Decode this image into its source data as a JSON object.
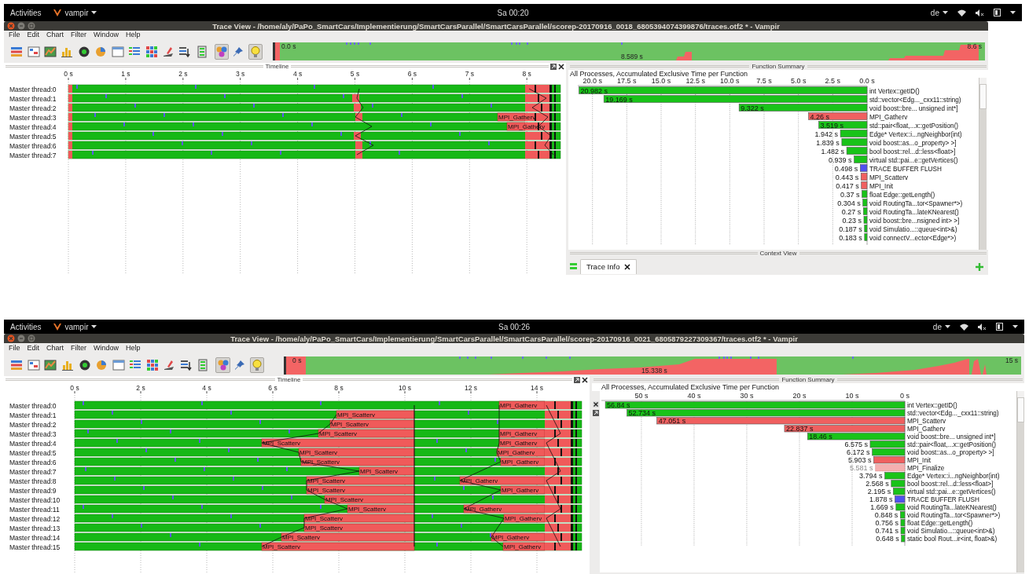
{
  "windows": [
    {
      "top_bar": {
        "activities": "Activities",
        "app_menu": "vampir",
        "clock": "Sa 00:20",
        "language": "de"
      },
      "title": "Trace View - /home/aly/PaPo_SmartCars/Implementierung/SmartCarsParallel/SmartCarsParallel/scorep-20170916_0018_6805394074399876/traces.otf2 * - Vampir",
      "menu": [
        "File",
        "Edit",
        "Chart",
        "Filter",
        "Window",
        "Help"
      ],
      "toolbar": [
        {
          "selected": false
        },
        {
          "selected": false
        },
        {
          "selected": false
        },
        {
          "selected": false
        },
        {
          "selected": false
        },
        {
          "selected": false
        },
        {
          "selected": false
        },
        {
          "selected": false
        },
        {
          "selected": false
        },
        {
          "selected": false
        },
        {
          "selected": false
        },
        {
          "selected": false
        },
        {
          "selected": true
        },
        {
          "selected": false
        },
        {
          "selected": true
        }
      ],
      "overview": {
        "start": "0.0 s",
        "cursor": "8.589 s",
        "end": "8.6 s"
      },
      "timeline": {
        "title": "Timeline",
        "ticks": [
          "0 s",
          "1 s",
          "2 s",
          "3 s",
          "4 s",
          "5 s",
          "6 s",
          "7 s",
          "8 s"
        ],
        "threads": [
          {
            "name": "Master thread:0"
          },
          {
            "name": "Master thread:1"
          },
          {
            "name": "Master thread:2"
          },
          {
            "name": "Master thread:3",
            "labels": [
              "MPI_Gatherv"
            ]
          },
          {
            "name": "Master thread:4",
            "labels": [
              "MPI_Gatherv"
            ]
          },
          {
            "name": "Master thread:5"
          },
          {
            "name": "Master thread:6"
          },
          {
            "name": "Master thread:7"
          }
        ]
      },
      "function_summary": {
        "title": "Function Summary",
        "chart_data": {
          "type": "bar",
          "orientation": "horizontal",
          "title": "All Processes, Accumulated Exclusive Time per Function",
          "categories": [
            "int Vertex::getID()",
            "std::vector<Edg..._cxx11::string)",
            "void boost::bre... unsigned int*]",
            "MPI_Gatherv",
            "std::pair<float,...x::getPosition()",
            "Edge* Vertex::i...ngNeighbor(int)",
            "void boost::as...o_property> >]",
            "bool boost::rel...d::less<float>]",
            "virtual std::pai...e::getVertices()",
            "TRACE BUFFER FLUSH",
            "MPI_Scatterv",
            "MPI_Init",
            "float Edge::getLength()",
            "void RoutingTa...tor<Spawner*>)",
            "void RoutingTa...lateKNearest()",
            "void boost::bre...nsigned int> >]",
            "void Simulatio...::queue<int>&)",
            "void connectV...ector<Edge*>)"
          ],
          "series": [
            {
              "color": "#19c319",
              "values": [
                20.982,
                19.169,
                9.322,
                null,
                3.519,
                1.942,
                1.839,
                1.482,
                0.939,
                null,
                null,
                null,
                0.37,
                0.304,
                0.27,
                0.23,
                0.187,
                0.183
              ]
            },
            {
              "color": "#f06060",
              "values": [
                null,
                null,
                null,
                4.26,
                null,
                null,
                null,
                null,
                null,
                null,
                0.443,
                0.417,
                null,
                null,
                null,
                null,
                null,
                null
              ]
            },
            {
              "color": "#5050f0",
              "values": [
                null,
                null,
                null,
                null,
                null,
                null,
                null,
                null,
                null,
                0.498,
                null,
                null,
                null,
                null,
                null,
                null,
                null,
                null
              ]
            }
          ],
          "grid": true,
          "xlim": [
            21.07,
            0
          ],
          "xticks": [
            {
              "value": 20,
              "label": "20.0 s"
            },
            {
              "value": 17.5,
              "label": "17.5 s"
            },
            {
              "value": 15,
              "label": "15.0 s"
            },
            {
              "value": 12.5,
              "label": "12.5 s"
            },
            {
              "value": 10,
              "label": "10.0 s"
            },
            {
              "value": 7.5,
              "label": "7.5 s"
            },
            {
              "value": 5,
              "label": "5.0 s"
            },
            {
              "value": 2.5,
              "label": "2.5 s"
            },
            {
              "value": 0,
              "label": "0.0 s"
            }
          ],
          "value_labels": [
            "20.982 s",
            "19.169 s",
            "9.322 s",
            "4.26 s",
            "3.519 s",
            "1.942 s",
            "1.839 s",
            "1.482 s",
            "0.939 s",
            "0.498 s",
            "0.443 s",
            "0.417 s",
            "0.37 s",
            "0.304 s",
            "0.27 s",
            "0.23 s",
            "0.187 s",
            "0.183 s"
          ]
        }
      },
      "context_view": {
        "title": "Context View",
        "tabs": [
          {
            "label": "Trace Info",
            "selected": true
          }
        ]
      }
    },
    {
      "top_bar": {
        "activities": "Activities",
        "app_menu": "vampir",
        "clock": "Sa 00:26",
        "language": "de"
      },
      "title": "Trace View - /home/aly/PaPo_SmartCars/Implementierung/SmartCarsParallel/SmartCarsParallel/scorep-20170916_0021_6805879227309367/traces.otf2 * - Vampir",
      "menu": [
        "File",
        "Edit",
        "Chart",
        "Filter",
        "Window",
        "Help"
      ],
      "toolbar": [
        {
          "selected": false
        },
        {
          "selected": false
        },
        {
          "selected": false
        },
        {
          "selected": false
        },
        {
          "selected": false
        },
        {
          "selected": false
        },
        {
          "selected": false
        },
        {
          "selected": false
        },
        {
          "selected": false
        },
        {
          "selected": false
        },
        {
          "selected": false
        },
        {
          "selected": false
        },
        {
          "selected": true
        },
        {
          "selected": false
        },
        {
          "selected": true
        }
      ],
      "overview": {
        "start": "0 s",
        "cursor": "15.338 s",
        "end": "15 s"
      },
      "timeline": {
        "title": "Timeline",
        "ticks": [
          "0 s",
          "2 s",
          "4 s",
          "6 s",
          "8 s",
          "10 s",
          "12 s",
          "14 s"
        ],
        "threads": [
          {
            "name": "Master thread:0",
            "labels": [
              "MPI_Gatherv"
            ]
          },
          {
            "name": "Master thread:1",
            "labels": [
              "MPI_Scatterv"
            ]
          },
          {
            "name": "Master thread:2",
            "labels": [
              "MPI_Scatterv"
            ]
          },
          {
            "name": "Master thread:3",
            "labels": [
              "MPI_Scatterv",
              "MPI_Gatherv"
            ]
          },
          {
            "name": "Master thread:4",
            "labels": [
              "MPI_Scatterv",
              "MPI_Gatherv"
            ]
          },
          {
            "name": "Master thread:5",
            "labels": [
              "MPI_Scatterv",
              "MPI_Gatherv"
            ]
          },
          {
            "name": "Master thread:6",
            "labels": [
              "MPI_Scatterv",
              "MPI_Gatherv"
            ]
          },
          {
            "name": "Master thread:7",
            "labels": [
              "MPI_Scatterv"
            ]
          },
          {
            "name": "Master thread:8",
            "labels": [
              "MPI_Scatterv",
              "MPI_Gatherv"
            ]
          },
          {
            "name": "Master thread:9",
            "labels": [
              "MPI_Scatterv",
              "MPI_Gatherv"
            ]
          },
          {
            "name": "Master thread:10",
            "labels": [
              "MPI_Scatterv"
            ]
          },
          {
            "name": "Master thread:11",
            "labels": [
              "MPI_Scatterv",
              "MPI_Gatherv"
            ]
          },
          {
            "name": "Master thread:12",
            "labels": [
              "MPI_Scatterv",
              "MPI_Gatherv"
            ]
          },
          {
            "name": "Master thread:13",
            "labels": [
              "MPI_Scatterv"
            ]
          },
          {
            "name": "Master thread:14",
            "labels": [
              "MPI_Scatterv",
              "MPI_Gatherv"
            ]
          },
          {
            "name": "Master thread:15",
            "labels": [
              "MPI_Scatterv",
              "MPI_Gatherv"
            ]
          }
        ]
      },
      "function_summary": {
        "title": "Function Summary",
        "chart_data": {
          "type": "bar",
          "orientation": "horizontal",
          "title": "All Processes, Accumulated Exclusive Time per Function",
          "categories": [
            "int Vertex::getID()",
            "std::vector<Edg..._cxx11::string)",
            "MPI_Scatterv",
            "MPI_Gatherv",
            "void boost::bre... unsigned int*]",
            "std::pair<float,...x::getPosition()",
            "void boost::as...o_property> >]",
            "MPI_Init",
            "MPI_Finalize",
            "Edge* Vertex::i...ngNeighbor(int)",
            "bool boost::rel...d::less<float>]",
            "virtual std::pai...e::getVertices()",
            "TRACE BUFFER FLUSH",
            "void RoutingTa...lateKNearest()",
            "void RoutingTa...tor<Spawner*>)",
            "float Edge::getLength()",
            "void Simulatio...::queue<int>&)",
            "static bool Rout...ir<int, float>&)"
          ],
          "series": [
            {
              "color": "#19c319",
              "values": [
                56.84,
                52.734,
                null,
                null,
                18.46,
                6.575,
                6.172,
                null,
                null,
                3.794,
                2.568,
                2.195,
                null,
                1.669,
                0.848,
                0.756,
                0.741,
                0.648
              ]
            },
            {
              "color": "#f06060",
              "values": [
                null,
                null,
                47.051,
                22.837,
                null,
                null,
                null,
                5.903,
                null,
                null,
                null,
                null,
                null,
                null,
                null,
                null,
                null,
                null
              ]
            },
            {
              "color": "#f5b0b0",
              "values": [
                null,
                null,
                null,
                null,
                null,
                null,
                null,
                null,
                5.581,
                null,
                null,
                null,
                null,
                null,
                null,
                null,
                null,
                null
              ]
            },
            {
              "color": "#5050f0",
              "values": [
                null,
                null,
                null,
                null,
                null,
                null,
                null,
                null,
                null,
                null,
                null,
                null,
                1.878,
                null,
                null,
                null,
                null,
                null
              ]
            }
          ],
          "grid": true,
          "xlim": [
            57.6,
            0
          ],
          "xticks": [
            {
              "value": 50,
              "label": "50 s"
            },
            {
              "value": 40,
              "label": "40 s"
            },
            {
              "value": 30,
              "label": "30 s"
            },
            {
              "value": 20,
              "label": "20 s"
            },
            {
              "value": 10,
              "label": "10 s"
            },
            {
              "value": 0,
              "label": "0 s"
            }
          ],
          "value_labels": [
            "56.84 s",
            "52.734 s",
            "47.051 s",
            "22.837 s",
            "18.46 s",
            "6.575 s",
            "6.172 s",
            "5.903 s",
            "5.581 s",
            "3.794 s",
            "2.568 s",
            "2.195 s",
            "1.878 s",
            "1.669 s",
            "0.848 s",
            "0.756 s",
            "0.741 s",
            "0.648 s"
          ]
        }
      }
    }
  ]
}
